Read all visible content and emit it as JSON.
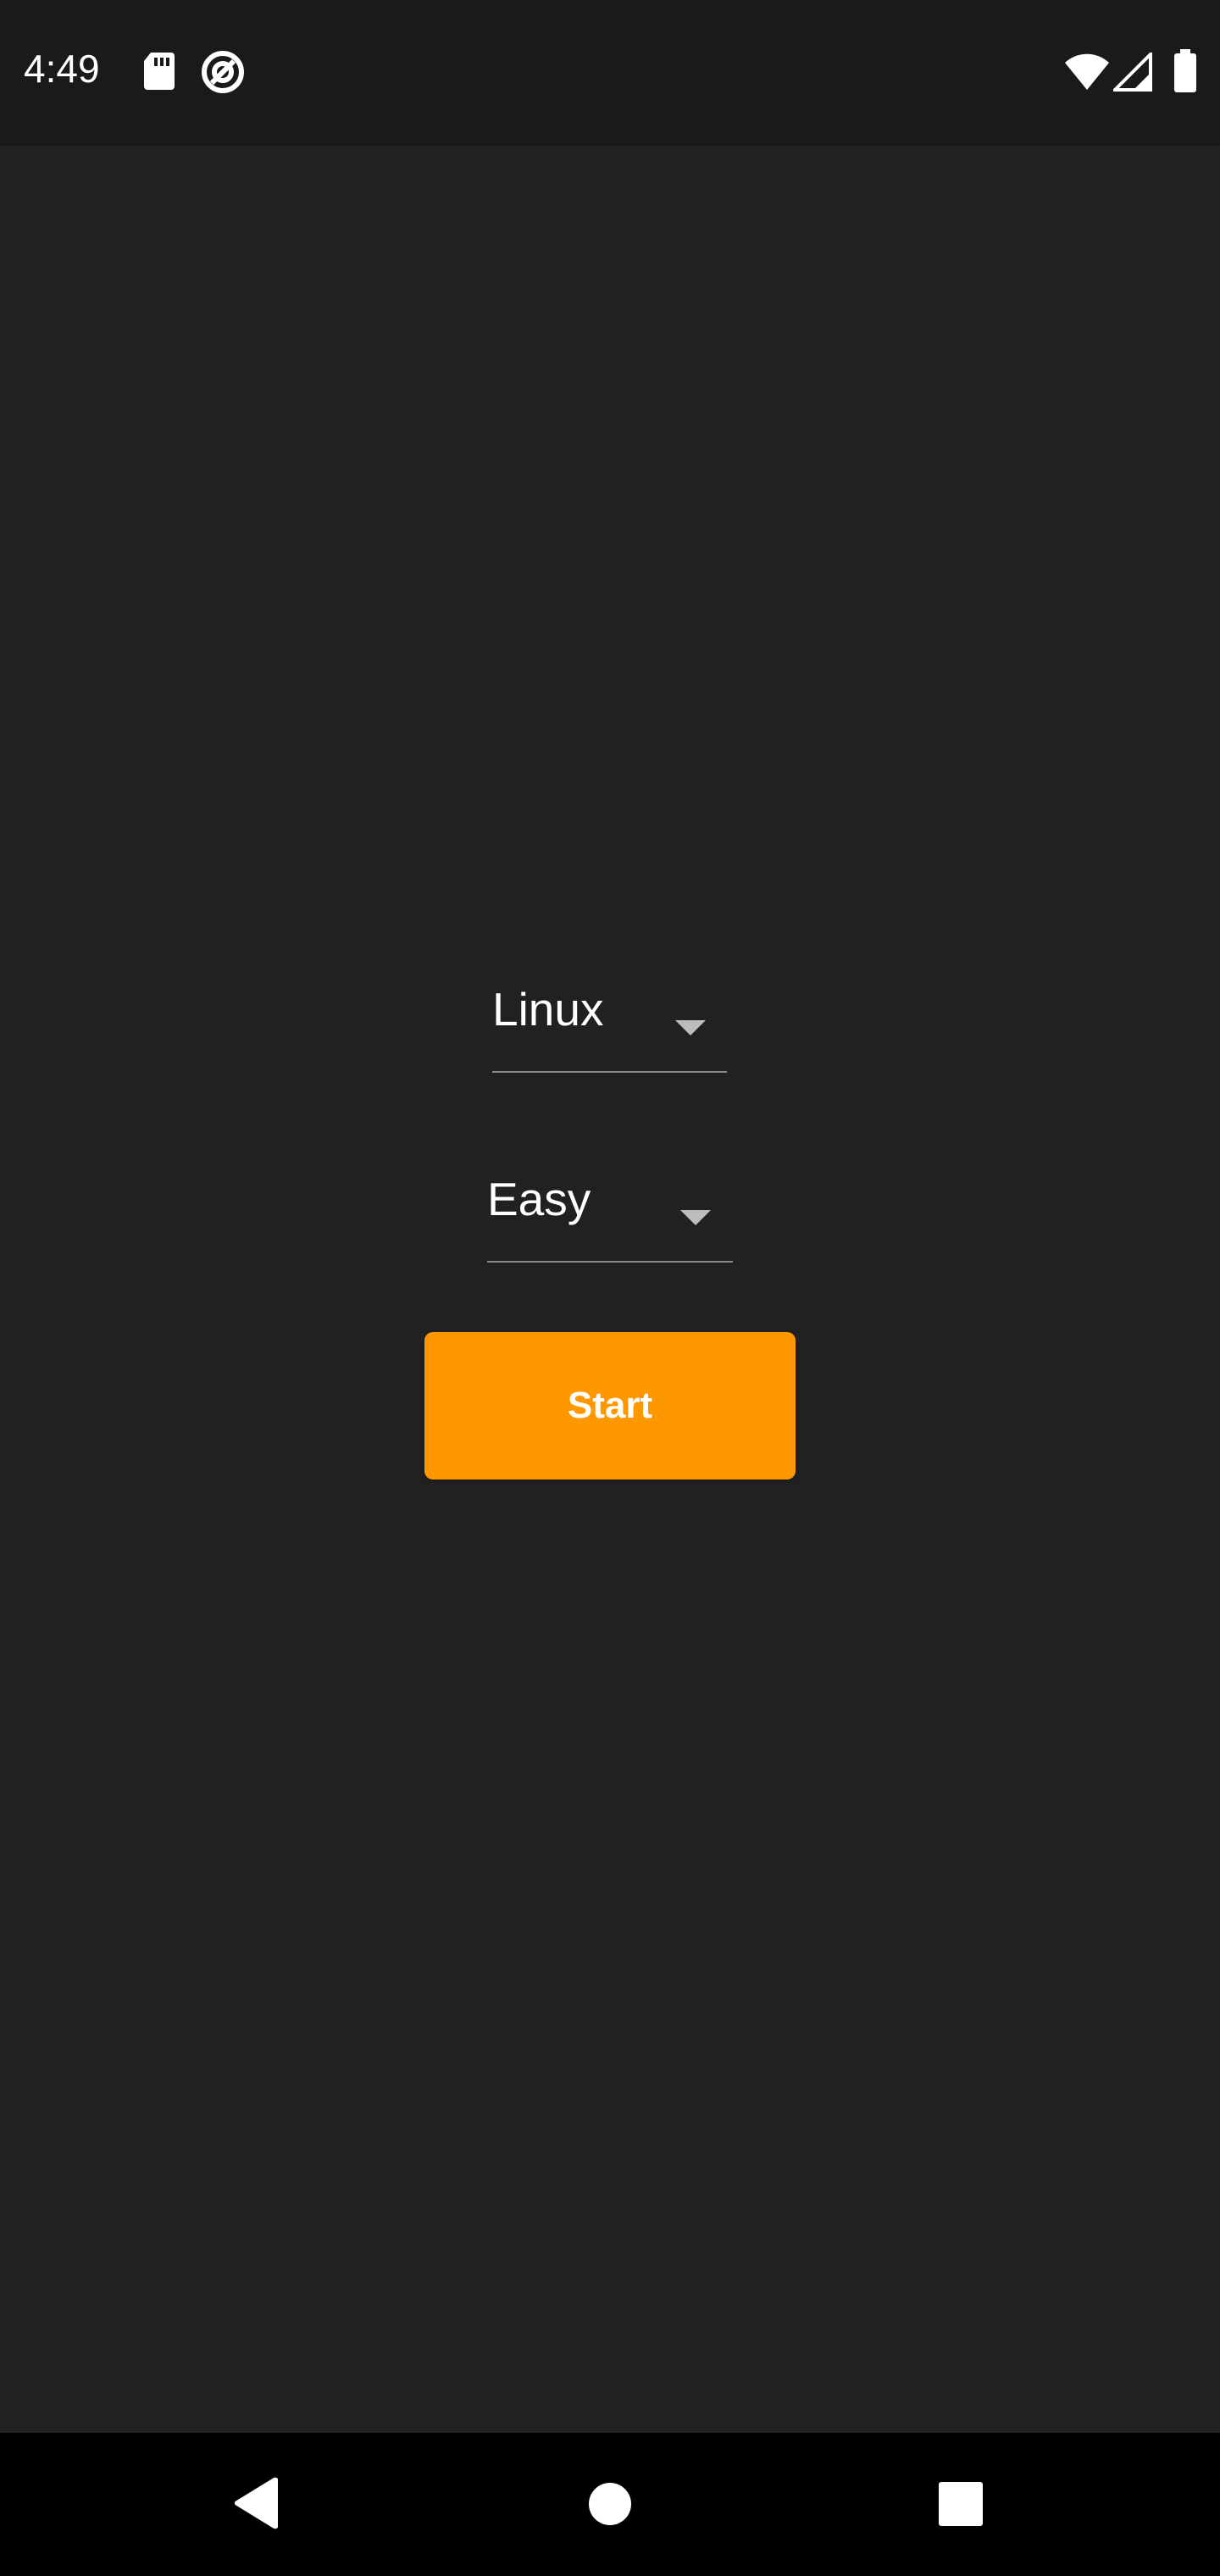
{
  "status_bar": {
    "time": "4:49",
    "left_icons": [
      "sd-card-icon",
      "data-saver-icon"
    ],
    "right_icons": [
      "wifi-icon",
      "cell-signal-icon",
      "battery-icon"
    ]
  },
  "main": {
    "platform_dropdown": {
      "selected": "Linux",
      "icon": "chevron-down-icon"
    },
    "difficulty_dropdown": {
      "selected": "Easy",
      "icon": "chevron-down-icon"
    },
    "start_button": {
      "label": "Start",
      "color": "#ff9800"
    }
  },
  "nav_bar": {
    "buttons": [
      "back-icon",
      "home-icon",
      "recents-icon"
    ]
  },
  "colors": {
    "background": "#212121",
    "status_bar": "#1a1a1a",
    "nav_bar": "#000000",
    "accent": "#ff9800",
    "text": "#ffffff"
  }
}
